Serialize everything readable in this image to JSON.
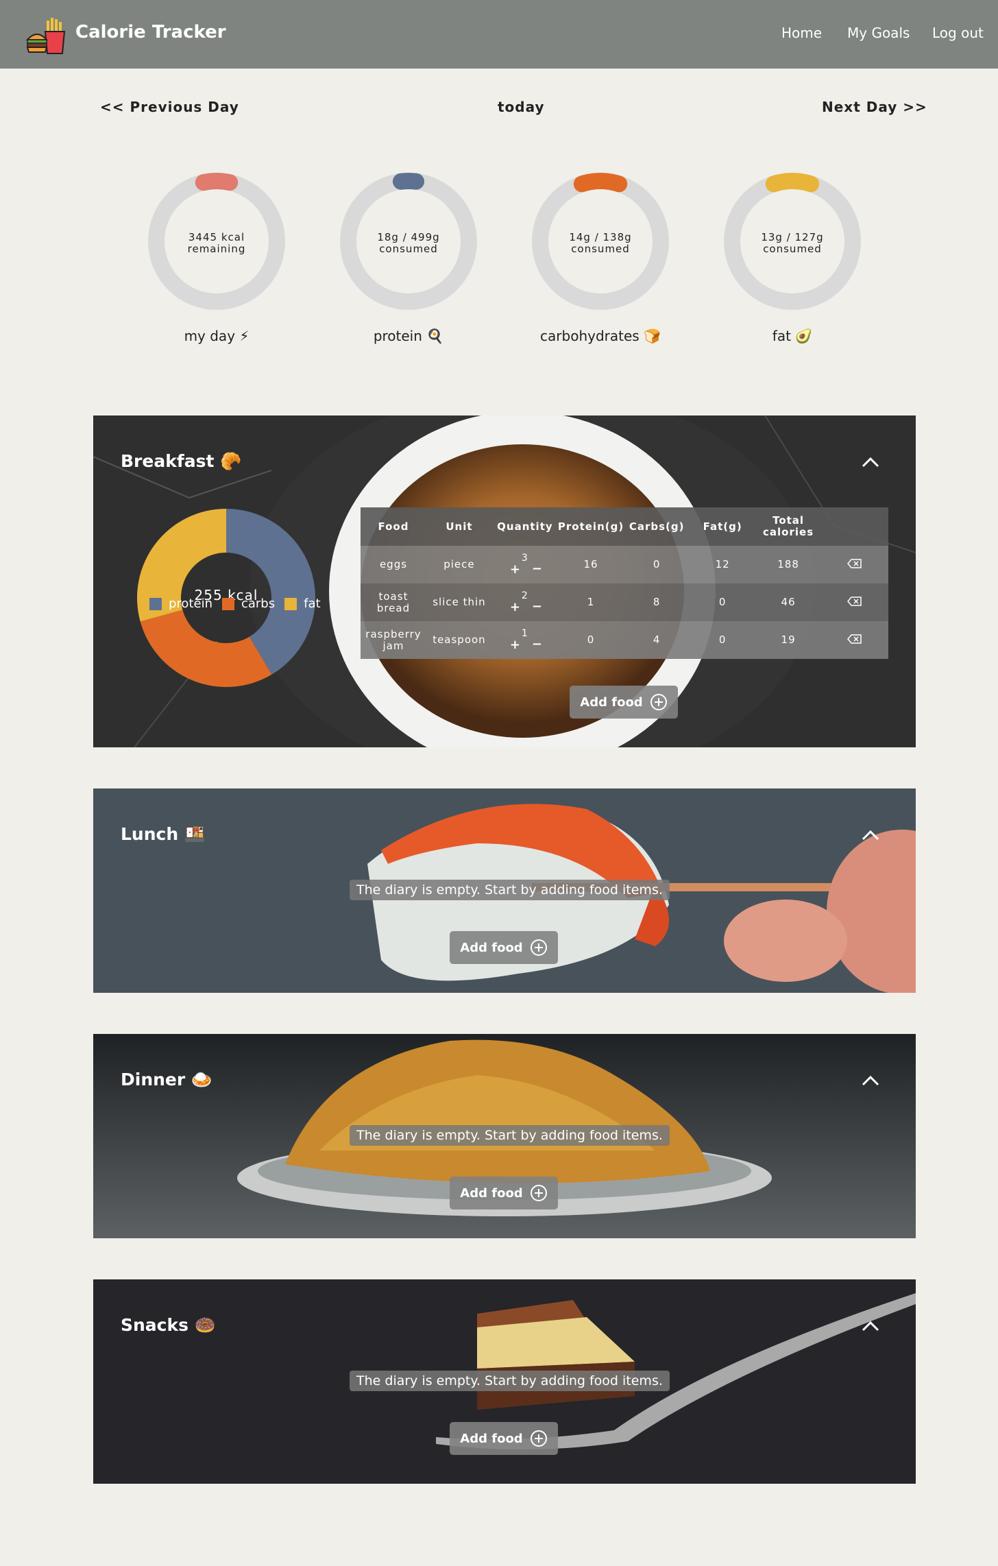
{
  "header": {
    "brand": "Calorie Tracker",
    "nav": [
      "Home",
      "My Goals",
      "Log out"
    ]
  },
  "day_nav": {
    "previous": "<< Previous Day",
    "current": "today",
    "next": "Next Day >>"
  },
  "rings": [
    {
      "line1": "3445 kcal",
      "line2": "remaining",
      "label": "my day ⚡",
      "color": "#e07b6e",
      "fraction": 0.07
    },
    {
      "line1": "18g / 499g",
      "line2": "consumed",
      "label": "protein 🍳",
      "color": "#5e7190",
      "fraction": 0.04
    },
    {
      "line1": "14g / 138g",
      "line2": "consumed",
      "label": "carbohydrates 🍞",
      "color": "#e06a25",
      "fraction": 0.1
    },
    {
      "line1": "13g / 127g",
      "line2": "consumed",
      "label": "fat 🥑",
      "color": "#e9b43a",
      "fraction": 0.1
    }
  ],
  "colors": {
    "protein": "#5e7190",
    "carbs": "#e06a25",
    "fat": "#e9b43a",
    "ring_track": "#d9d9d9"
  },
  "meals": {
    "breakfast": {
      "title": "Breakfast 🥐",
      "donut_label": "255 kcal",
      "legend": [
        "protein",
        "carbs",
        "fat"
      ],
      "columns": [
        "Food",
        "Unit",
        "Quantity",
        "Protein(g)",
        "Carbs(g)",
        "Fat(g)",
        "Total calories"
      ],
      "rows": [
        {
          "food": "eggs",
          "unit": "piece",
          "quantity": "3",
          "protein": "16",
          "carbs": "0",
          "fat": "12",
          "calories": "188"
        },
        {
          "food": "toast bread",
          "unit": "slice thin",
          "quantity": "2",
          "protein": "1",
          "carbs": "8",
          "fat": "0",
          "calories": "46"
        },
        {
          "food": "raspberry jam",
          "unit": "teaspoon",
          "quantity": "1",
          "protein": "0",
          "carbs": "4",
          "fat": "0",
          "calories": "19"
        }
      ],
      "add_label": "Add food"
    },
    "lunch": {
      "title": "Lunch 🍱",
      "empty": "The diary is empty. Start by adding food items.",
      "add_label": "Add food"
    },
    "dinner": {
      "title": "Dinner 🍛",
      "empty": "The diary is empty. Start by adding food items.",
      "add_label": "Add food"
    },
    "snacks": {
      "title": "Snacks 🍩",
      "empty": "The diary is empty. Start by adding food items.",
      "add_label": "Add food"
    }
  },
  "chart_data": {
    "type": "pie",
    "title": "255 kcal",
    "categories": [
      "protein",
      "carbs",
      "fat"
    ],
    "values": [
      17,
      12,
      12
    ],
    "colors": [
      "#5e7190",
      "#e06a25",
      "#e9b43a"
    ]
  }
}
